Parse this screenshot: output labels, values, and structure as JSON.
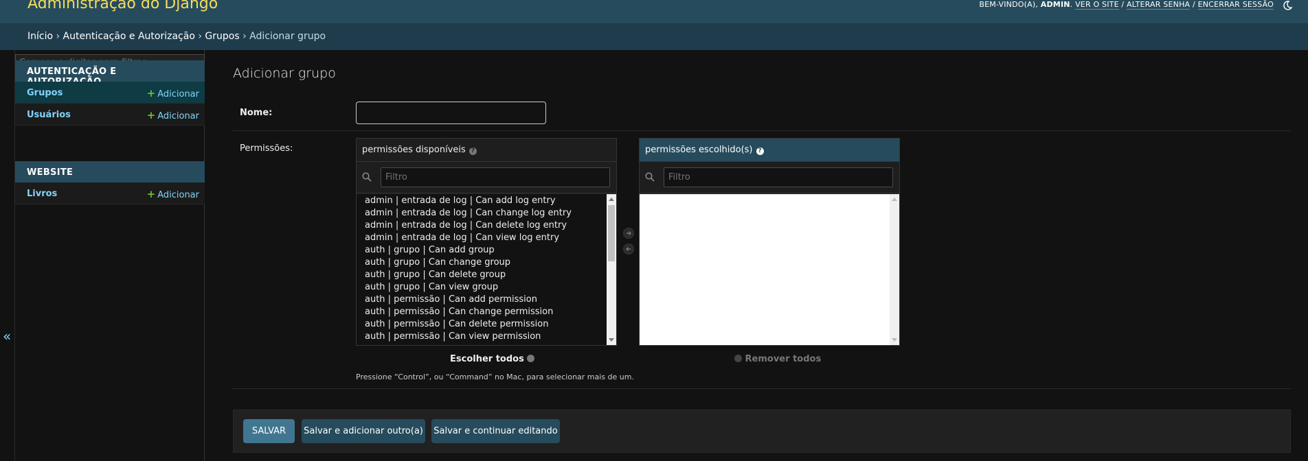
{
  "header": {
    "site_name": "Administração do Django",
    "welcome": "BEM-VINDO(A),",
    "username": "ADMIN",
    "links": [
      "VER O SITE",
      "ALTERAR SENHA",
      "ENCERRAR SESSÃO"
    ]
  },
  "breadcrumbs": [
    "Início",
    "Autenticação e Autorização",
    "Grupos",
    "Adicionar grupo"
  ],
  "sidebar": {
    "filter_placeholder": "Comece a digitar para filtrar...",
    "modules": [
      {
        "caption": "Autenticação e Autorização",
        "items": [
          {
            "label": "Grupos",
            "add_label": "Adicionar"
          },
          {
            "label": "Usuários",
            "add_label": "Adicionar"
          }
        ]
      },
      {
        "caption": "Website",
        "items": [
          {
            "label": "Livros",
            "add_label": "Adicionar"
          }
        ]
      }
    ],
    "collapse_glyph": "«"
  },
  "content": {
    "title": "Adicionar grupo",
    "name_label": "Nome:",
    "name_value": "",
    "permissions_label": "Permissões:",
    "available": {
      "title": "permissões disponíveis",
      "filter_placeholder": "Filtro",
      "options": [
        "admin | entrada de log | Can add log entry",
        "admin | entrada de log | Can change log entry",
        "admin | entrada de log | Can delete log entry",
        "admin | entrada de log | Can view log entry",
        "auth | grupo | Can add group",
        "auth | grupo | Can change group",
        "auth | grupo | Can delete group",
        "auth | grupo | Can view group",
        "auth | permissão | Can add permission",
        "auth | permissão | Can change permission",
        "auth | permissão | Can delete permission",
        "auth | permissão | Can view permission"
      ],
      "choose_all": "Escolher todos"
    },
    "chosen": {
      "title": "permissões escolhido(s)",
      "filter_placeholder": "Filtro",
      "remove_all": "Remover todos"
    },
    "help_text": "Pressione “Control”, ou “Command” no Mac, para selecionar mais de um."
  },
  "submit": {
    "save": "Salvar",
    "save_add_another": "Salvar e adicionar outro(a)",
    "save_continue": "Salvar e continuar editando"
  },
  "colors": {
    "header_bg": "#264b5d",
    "breadcrumbs_bg": "#1f3c4d",
    "brand_yellow": "#f5dd5d",
    "link_blue": "#81d4fa",
    "add_green": "#70bf2b",
    "primary_button": "#417690"
  },
  "icons": [
    "moon-icon",
    "search-icon",
    "help-icon",
    "arrow-right-icon",
    "arrow-left-icon",
    "plus-icon",
    "chevron-double-left-icon"
  ]
}
